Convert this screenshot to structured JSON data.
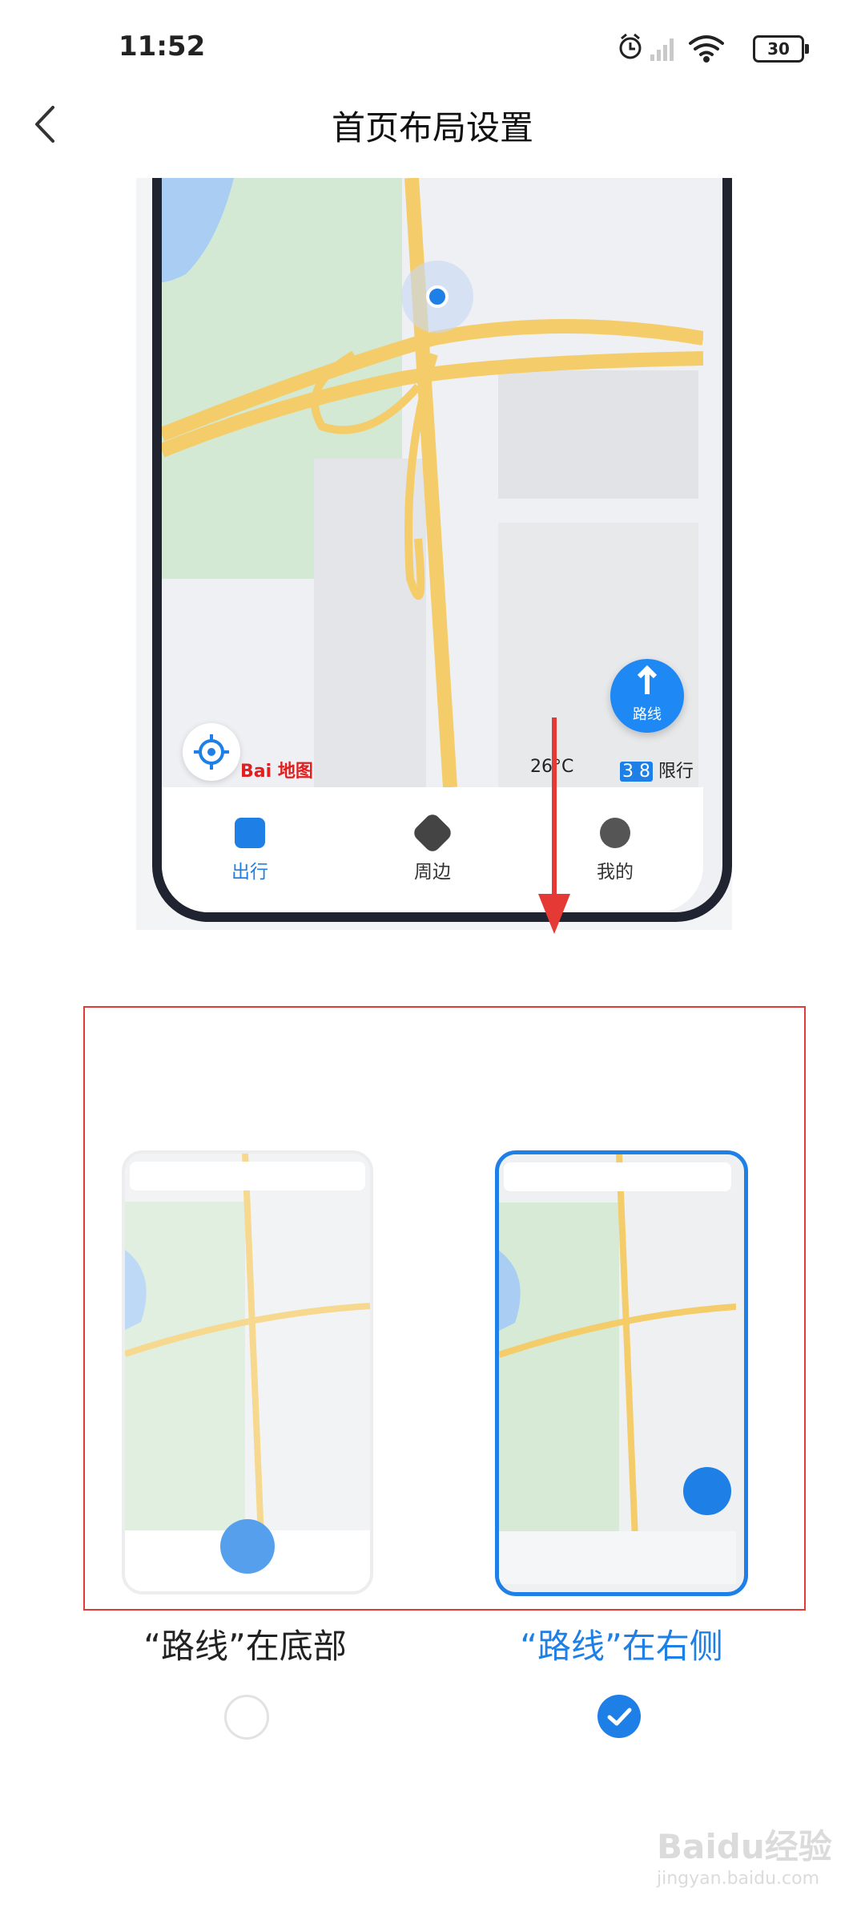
{
  "status_bar": {
    "time": "11:52",
    "battery": "30",
    "icons": [
      "alarm-icon",
      "signal-icon",
      "wifi-icon",
      "battery-icon"
    ]
  },
  "header": {
    "title": "首页布局设置",
    "back_icon": "chevron-left-icon"
  },
  "preview": {
    "logo": "Bai 地图",
    "weather": "26°C",
    "limit_numbers": "3 8",
    "limit_label": "限行",
    "route_button_label": "路线",
    "nav": [
      {
        "label": "出行",
        "icon": "travel-icon"
      },
      {
        "label": "周边",
        "icon": "compass-icon"
      },
      {
        "label": "我的",
        "icon": "profile-icon"
      }
    ]
  },
  "options": [
    {
      "label": "“路线”在底部",
      "route_label": "路线",
      "selected": false
    },
    {
      "label": "“路线”在右侧",
      "route_label": "路线",
      "selected": true
    }
  ],
  "watermark": {
    "brand": "Baidu经验",
    "url": "jingyan.baidu.com"
  },
  "colors": {
    "accent": "#1e7fe6",
    "highlight_border": "#e53935",
    "road": "#f4cd6a",
    "park": "#cfe6cf",
    "water": "#a9cdf3"
  }
}
